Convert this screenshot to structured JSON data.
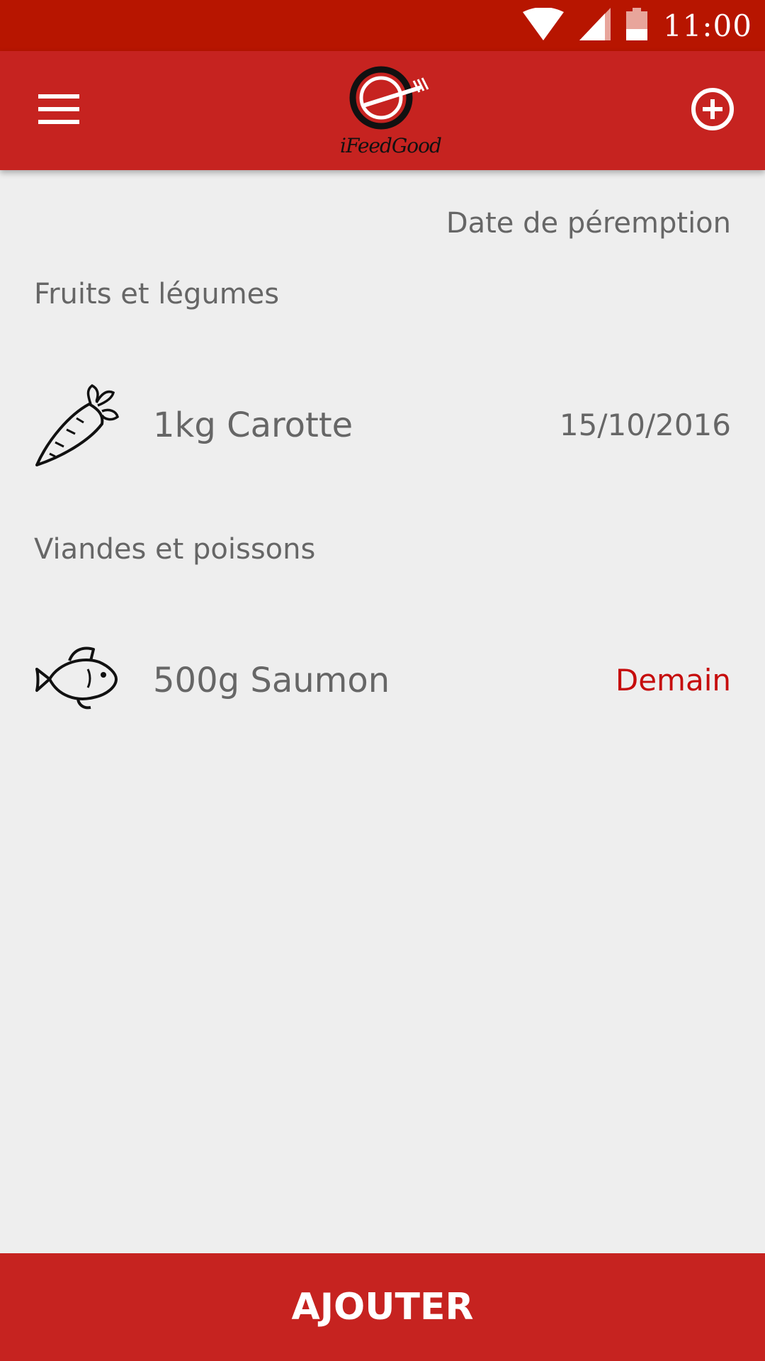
{
  "status_bar": {
    "time": "11:00",
    "icons": [
      "wifi-icon",
      "signal-icon",
      "battery-icon"
    ]
  },
  "app_bar": {
    "logo_text": "iFeedGood",
    "menu_icon": "hamburger-menu-icon",
    "add_icon": "add-circle-icon"
  },
  "list": {
    "column_header": "Date de péremption",
    "sections": [
      {
        "title": "Fruits et légumes",
        "items": [
          {
            "icon": "carrot-icon",
            "label": "1kg Carotte",
            "date": "15/10/2016"
          }
        ]
      },
      {
        "title": "Viandes et poissons",
        "items": [
          {
            "icon": "fish-icon",
            "label": "500g Saumon",
            "date": "Demain"
          }
        ]
      }
    ]
  },
  "colors": {
    "primary": "#c62320",
    "status_bar": "#b71500",
    "urgent": "#c60d0d",
    "background": "#eeeeee"
  },
  "bottom_button": {
    "label": "AJOUTER"
  }
}
